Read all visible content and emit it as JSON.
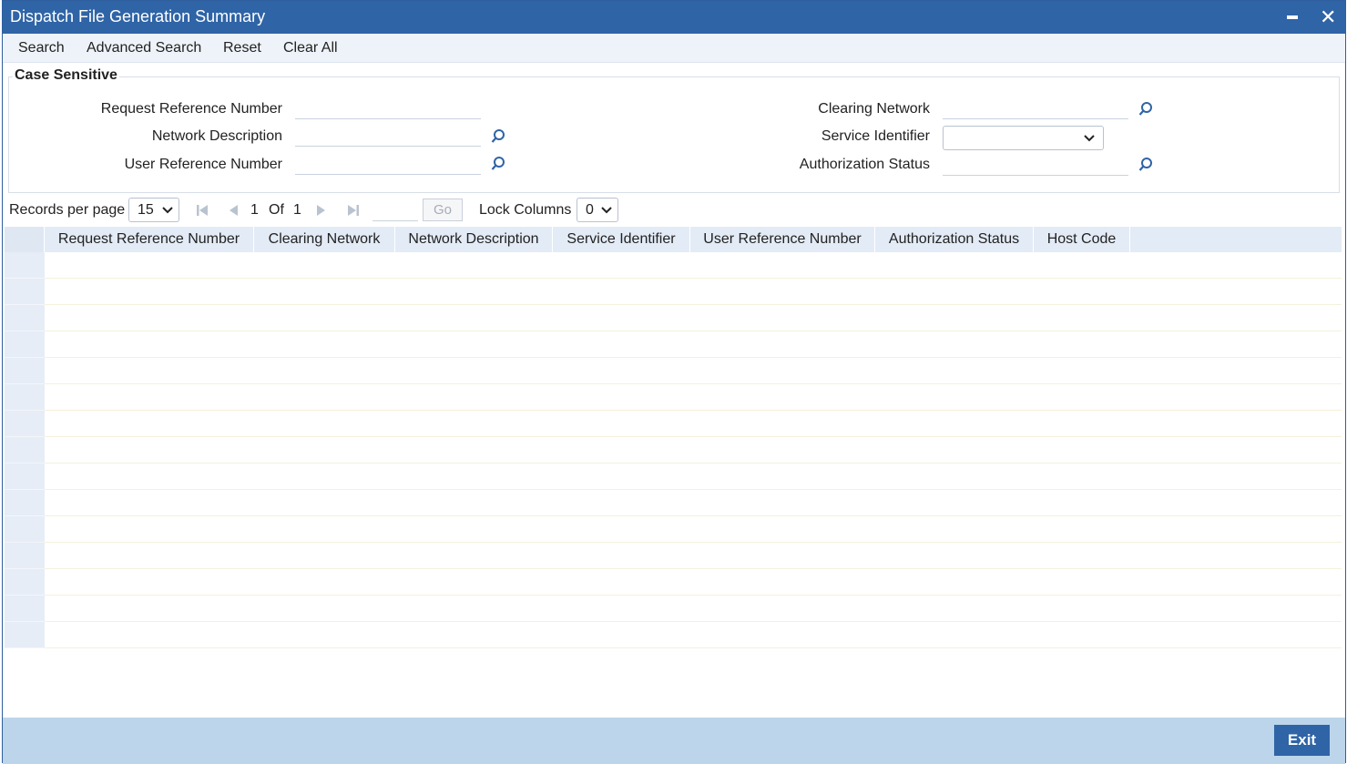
{
  "window": {
    "title": "Dispatch File Generation Summary",
    "minimize_glyph": "minimize-icon",
    "close_glyph": "✕"
  },
  "toolbar": {
    "search": "Search",
    "advanced_search": "Advanced Search",
    "reset": "Reset",
    "clear_all": "Clear All"
  },
  "criteria": {
    "legend": "Case Sensitive",
    "request_reference_number": {
      "label": "Request Reference Number",
      "value": ""
    },
    "network_description": {
      "label": "Network Description",
      "value": ""
    },
    "user_reference_number": {
      "label": "User Reference Number",
      "value": ""
    },
    "clearing_network": {
      "label": "Clearing Network",
      "value": ""
    },
    "service_identifier": {
      "label": "Service Identifier",
      "value": ""
    },
    "authorization_status": {
      "label": "Authorization Status",
      "value": ""
    }
  },
  "pager": {
    "records_per_page_label": "Records per page",
    "records_per_page_value": "15",
    "current_page": "1",
    "of_label": "Of",
    "total_pages": "1",
    "go_label": "Go",
    "lock_columns_label": "Lock Columns",
    "lock_columns_value": "0"
  },
  "grid": {
    "columns": [
      "Request Reference Number",
      "Clearing Network",
      "Network Description",
      "Service Identifier",
      "User Reference Number",
      "Authorization Status",
      "Host Code"
    ],
    "rows": []
  },
  "footer": {
    "exit": "Exit"
  },
  "colors": {
    "titlebar": "#2f64a6",
    "footer": "#bcd5ea",
    "grid_header": "#e3ebf6",
    "accent_icon": "#2f64a6"
  }
}
